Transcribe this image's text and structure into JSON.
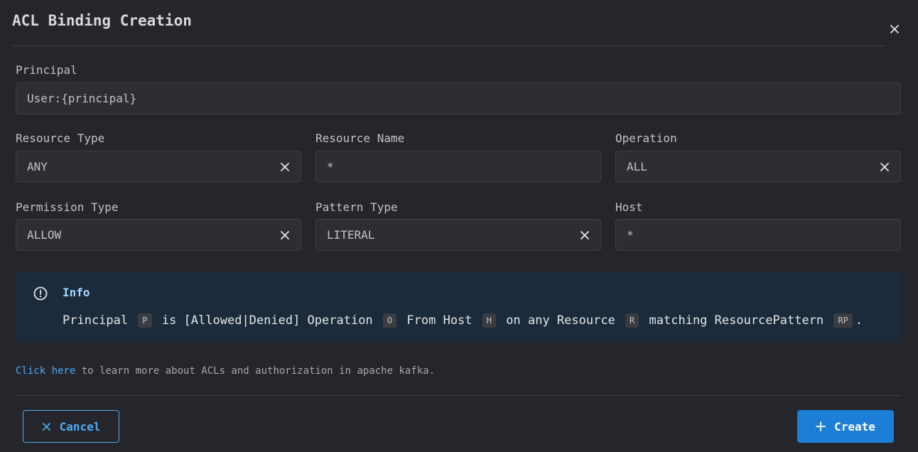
{
  "dialog": {
    "title": "ACL Binding Creation",
    "close_icon": "close-icon"
  },
  "form": {
    "principal": {
      "label": "Principal",
      "value": "User:{principal}"
    },
    "resource_type": {
      "label": "Resource Type",
      "value": "ANY"
    },
    "resource_name": {
      "label": "Resource Name",
      "value": "*"
    },
    "operation": {
      "label": "Operation",
      "value": "ALL"
    },
    "permission_type": {
      "label": "Permission Type",
      "value": "ALLOW"
    },
    "pattern_type": {
      "label": "Pattern Type",
      "value": "LITERAL"
    },
    "host": {
      "label": "Host",
      "value": "*"
    }
  },
  "info": {
    "title": "Info",
    "icon": "info-circle-icon",
    "parts": {
      "t1": "Principal",
      "c1": "P",
      "t2": "is [Allowed|Denied] Operation",
      "c2": "O",
      "t3": "From Host",
      "c3": "H",
      "t4": "on any Resource",
      "c4": "R",
      "t5": "matching ResourcePattern",
      "c5": "RP",
      "t6": "."
    }
  },
  "learn_more": {
    "link": "Click here",
    "text": " to learn more about ACLs and authorization in apache kafka."
  },
  "footer": {
    "cancel_label": "Cancel",
    "create_label": "Create"
  },
  "colors": {
    "background": "#25262b",
    "field_background": "#2c2e33",
    "accent": "#4dabf7",
    "primary_button": "#1c7ed6",
    "info_background": "#1b2b3c"
  }
}
